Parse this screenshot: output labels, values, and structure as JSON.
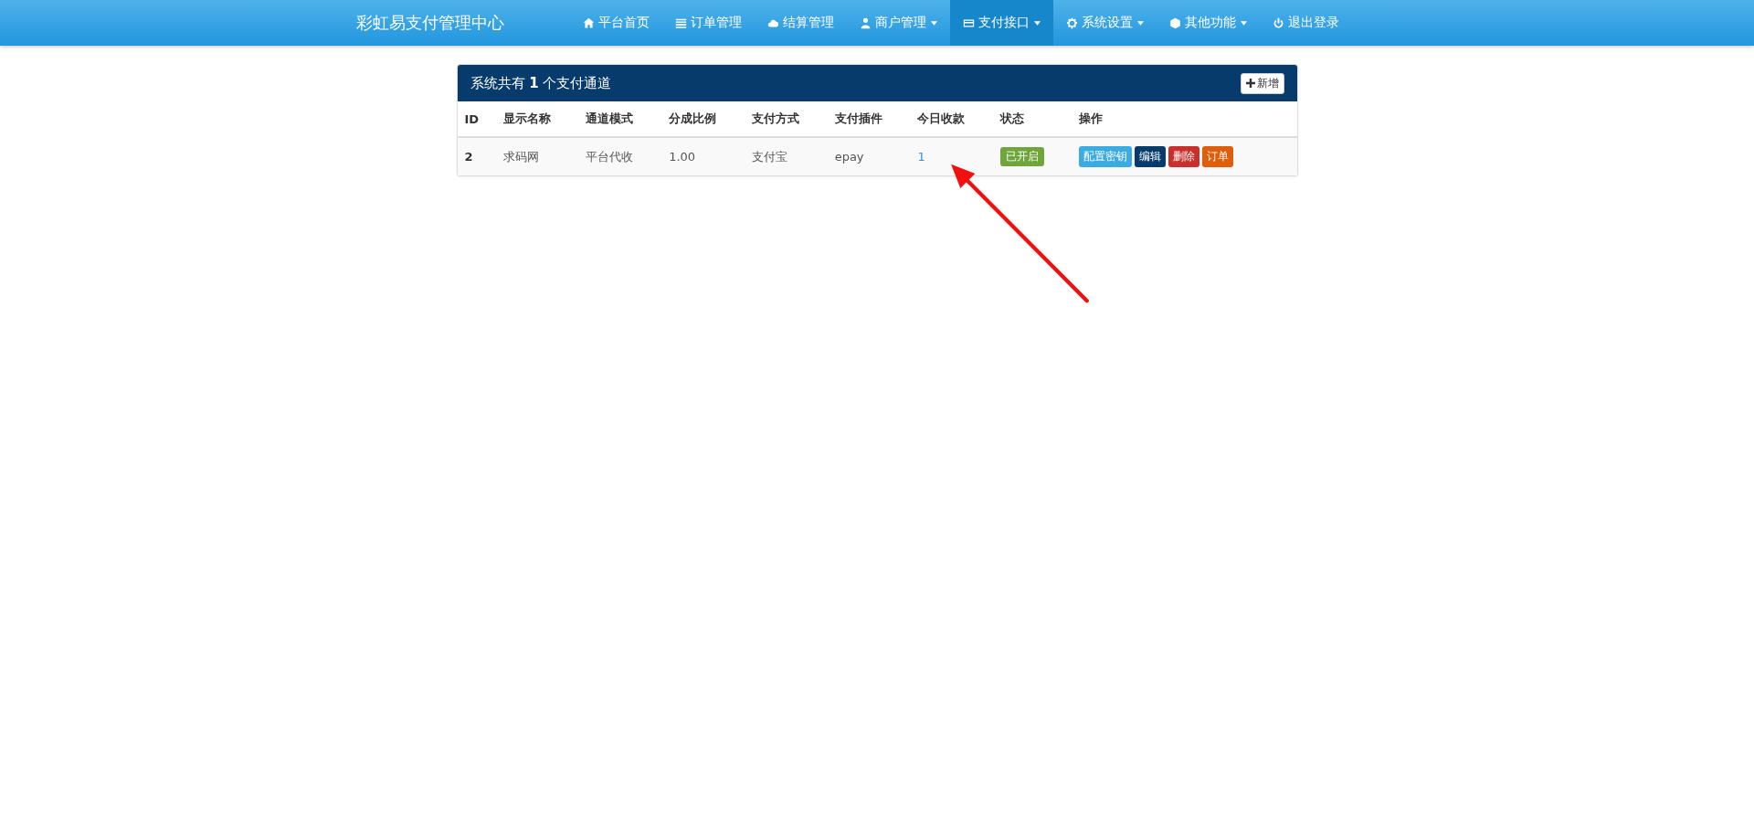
{
  "navbar": {
    "brand": "彩虹易支付管理中心",
    "items": [
      {
        "label": "平台首页",
        "dropdown": false,
        "selected": false
      },
      {
        "label": "订单管理",
        "dropdown": false,
        "selected": false
      },
      {
        "label": "结算管理",
        "dropdown": false,
        "selected": false
      },
      {
        "label": "商户管理",
        "dropdown": true,
        "selected": false
      },
      {
        "label": "支付接口",
        "dropdown": true,
        "selected": true
      },
      {
        "label": "系统设置",
        "dropdown": true,
        "selected": false
      },
      {
        "label": "其他功能",
        "dropdown": true,
        "selected": false
      },
      {
        "label": "退出登录",
        "dropdown": false,
        "selected": false
      }
    ]
  },
  "panel": {
    "title": "系统共有 **1** 个支付通道",
    "add_button": "新增",
    "table": {
      "columns": [
        "ID",
        "显示名称",
        "通道模式",
        "分成比例",
        "支付方式",
        "支付插件",
        "今日收款",
        "状态",
        "操作"
      ],
      "rows": [
        {
          "id": "2",
          "name": "求码网",
          "mode": "平台代收",
          "ratio": "1.00",
          "method": "支付宝",
          "plugin": "epay",
          "today": "1",
          "status": {
            "label": "已开启",
            "on": true
          },
          "actions": [
            {
              "label": "配置密钥",
              "color": "#3bace2"
            },
            {
              "label": "编辑",
              "color": "#073b6c"
            },
            {
              "label": "删除",
              "color": "#c9302c"
            },
            {
              "label": "订单",
              "color": "#e05d0b"
            }
          ]
        }
      ]
    }
  }
}
